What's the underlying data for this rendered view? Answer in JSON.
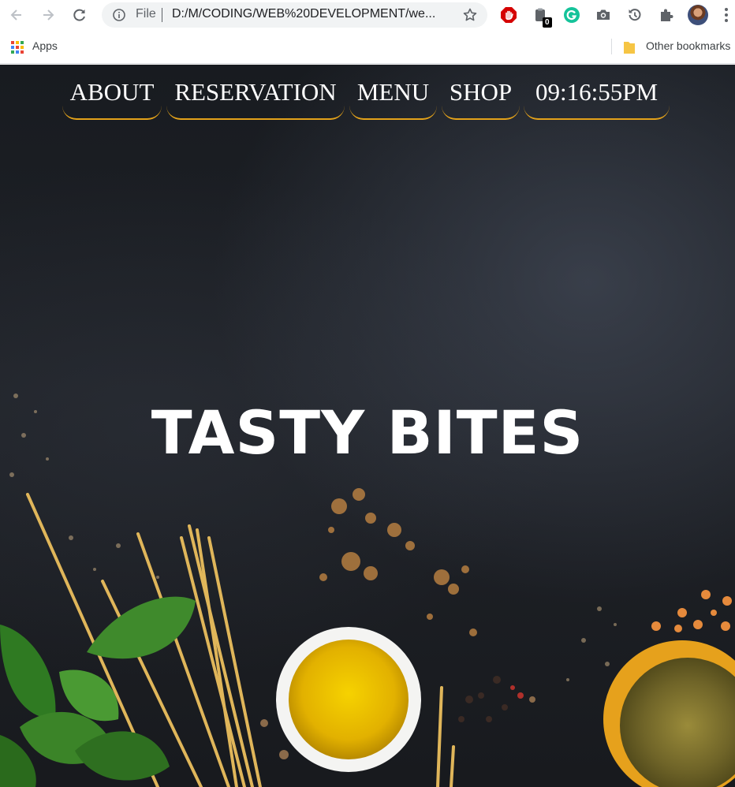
{
  "browser": {
    "url_prefix": "File",
    "url": "D:/M/CODING/WEB%20DEVELOPMENT/we...",
    "extension_badge": "0",
    "icons": [
      "back-icon",
      "forward-icon",
      "reload-icon",
      "info-icon",
      "star-icon",
      "adblock-icon",
      "extension-icon",
      "grammarly-icon",
      "camera-icon",
      "history-icon",
      "puzzle-icon",
      "avatar",
      "menu-icon"
    ]
  },
  "bookmarks": {
    "apps_label": "Apps",
    "other_label": "Other bookmarks"
  },
  "site": {
    "nav": [
      {
        "label": "ABOUT"
      },
      {
        "label": "RESERVATION"
      },
      {
        "label": "MENU"
      },
      {
        "label": "SHOP"
      },
      {
        "label": "09:16:55PM"
      }
    ],
    "title": "TASTY BITES",
    "accent_color": "#e3a21a"
  }
}
